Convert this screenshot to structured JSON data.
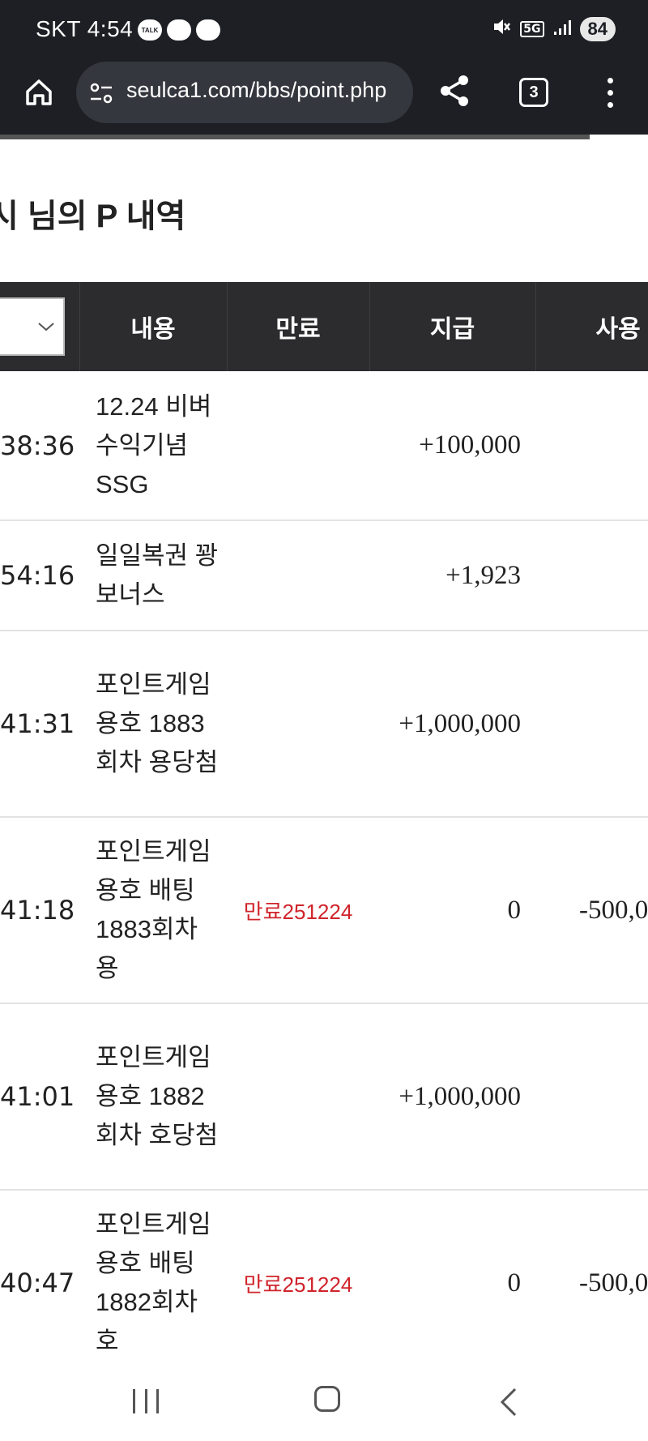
{
  "status_bar": {
    "carrier_time": "SKT 4:54",
    "notification_icons": [
      "kakaotalk-icon",
      "chat-bubble-icon",
      "chat-bubble-icon"
    ],
    "talk_label": "TALK",
    "network_label": "5G",
    "battery_level": "84"
  },
  "browser": {
    "url": "seulca1.com/bbs/point.php",
    "tab_count": "3",
    "icons": [
      "home-icon",
      "site-settings-icon",
      "share-icon",
      "tab-switcher-icon",
      "more-menu-icon"
    ],
    "load_progress_fraction": 0.91
  },
  "page": {
    "title": "시 님의 P 내역"
  },
  "table": {
    "headers": {
      "description": "내용",
      "expiry": "만료",
      "granted": "지급",
      "used": "사용"
    },
    "rows": [
      {
        "time": "38:36",
        "description": "12.24 비벼 수익기념 SSG",
        "expiry": "",
        "granted": "+100,000",
        "used": ""
      },
      {
        "time": "54:16",
        "description": "일일복권 꽝 보너스",
        "expiry": "",
        "granted": "+1,923",
        "used": ""
      },
      {
        "time": "41:31",
        "description": "포인트게임 용호 1883회차 용당첨",
        "expiry": "",
        "granted": "+1,000,000",
        "used": ""
      },
      {
        "time": "41:18",
        "description": "포인트게임 용호 배팅 1883회차 용",
        "expiry": "만료251224",
        "granted": "0",
        "used": "-500,0"
      },
      {
        "time": "41:01",
        "description": "포인트게임 용호 1882회차 호당첨",
        "expiry": "",
        "granted": "+1,000,000",
        "used": ""
      },
      {
        "time": "40:47",
        "description": "포인트게임 용호 배팅 1882회차 호",
        "expiry": "만료251224",
        "granted": "0",
        "used": "-500,0"
      }
    ]
  },
  "nav_bar": {
    "icons": [
      "recents-icon",
      "home-nav-icon",
      "back-icon"
    ]
  }
}
